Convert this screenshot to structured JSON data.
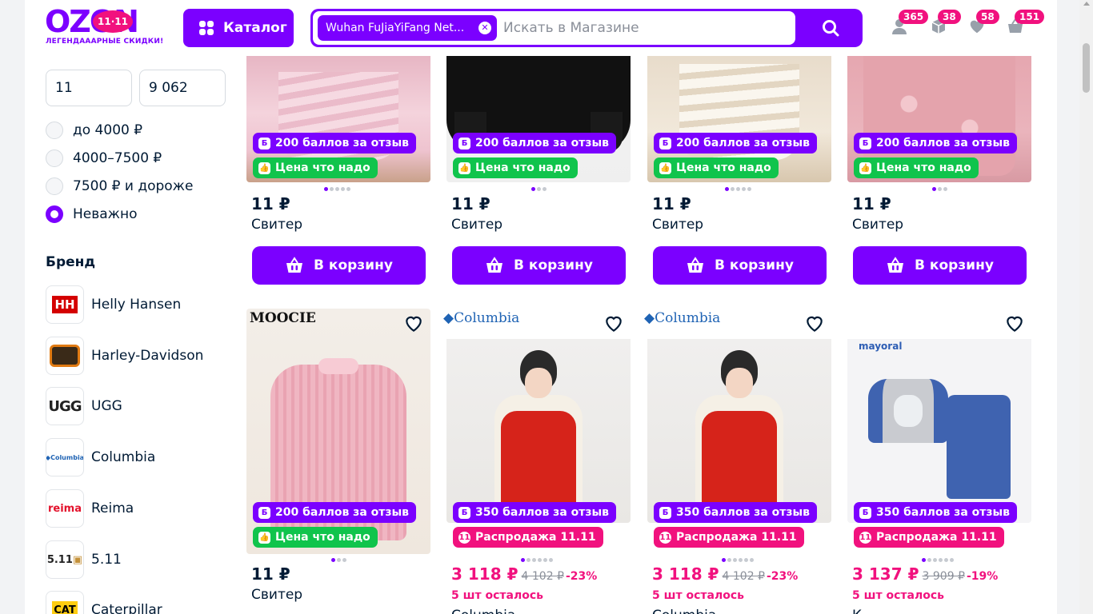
{
  "header": {
    "logo_text": "OZON",
    "logo_badge": "11·11",
    "logo_tagline": "ЛЕГЕНДАААРНЫЕ СКИДКИ!",
    "catalog_label": "Каталог",
    "search_chip": "Wuhan FuJiaYiFang Net...",
    "search_placeholder": "Искать в Магазине",
    "badges": {
      "profile": "365",
      "orders": "38",
      "favorites": "58",
      "cart": "151"
    }
  },
  "sidebar": {
    "price_from": "11",
    "price_to": "9 062",
    "price_options": [
      "до 4000 ₽",
      "4000–7500 ₽",
      "7500 ₽ и дороже",
      "Неважно"
    ],
    "selected_price_option": "Неважно",
    "brand_title": "Бренд",
    "brands": [
      "Helly Hansen",
      "Harley-Davidson",
      "UGG",
      "Columbia",
      "Reima",
      "5.11",
      "Caterpillar"
    ]
  },
  "products_row1": [
    {
      "bonus": "200 баллов за отзыв",
      "promo": "Цена что надо",
      "price": "11 ₽",
      "title": "Свитер",
      "cart": "В корзину"
    },
    {
      "bonus": "200 баллов за отзыв",
      "promo": "Цена что надо",
      "price": "11 ₽",
      "title": "Свитер",
      "cart": "В корзину"
    },
    {
      "bonus": "200 баллов за отзыв",
      "promo": "Цена что надо",
      "price": "11 ₽",
      "title": "Свитер",
      "cart": "В корзину"
    },
    {
      "bonus": "200 баллов за отзыв",
      "promo": "Цена что надо",
      "price": "11 ₽",
      "title": "Свитер",
      "cart": "В корзину"
    }
  ],
  "products_row2": [
    {
      "brand_label": "MOOCIE",
      "bonus": "200 баллов за отзыв",
      "promo": "Цена что надо",
      "price": "11 ₽",
      "title": "Свитер"
    },
    {
      "brand_label": "Columbia",
      "bonus": "350 баллов за отзыв",
      "promo": "Распродажа 11.11",
      "price": "3 118 ₽",
      "old_price": "4 102 ₽",
      "discount": "-23%",
      "stock": "5 шт осталось",
      "title": "Columbia"
    },
    {
      "brand_label": "Columbia",
      "bonus": "350 баллов за отзыв",
      "promo": "Распродажа 11.11",
      "price": "3 118 ₽",
      "old_price": "4 102 ₽",
      "discount": "-23%",
      "stock": "5 шт осталось",
      "title": "Columbia"
    },
    {
      "brand_label": "mayoral",
      "bonus": "350 баллов за отзыв",
      "promo": "Распродажа 11.11",
      "price": "3 137 ₽",
      "old_price": "3 909 ₽",
      "discount": "-19%",
      "stock": "5 шт осталось",
      "title": "К"
    }
  ],
  "colors": {
    "brand": "#7b00ff",
    "sale": "#f1117e",
    "green": "#10c44c"
  }
}
